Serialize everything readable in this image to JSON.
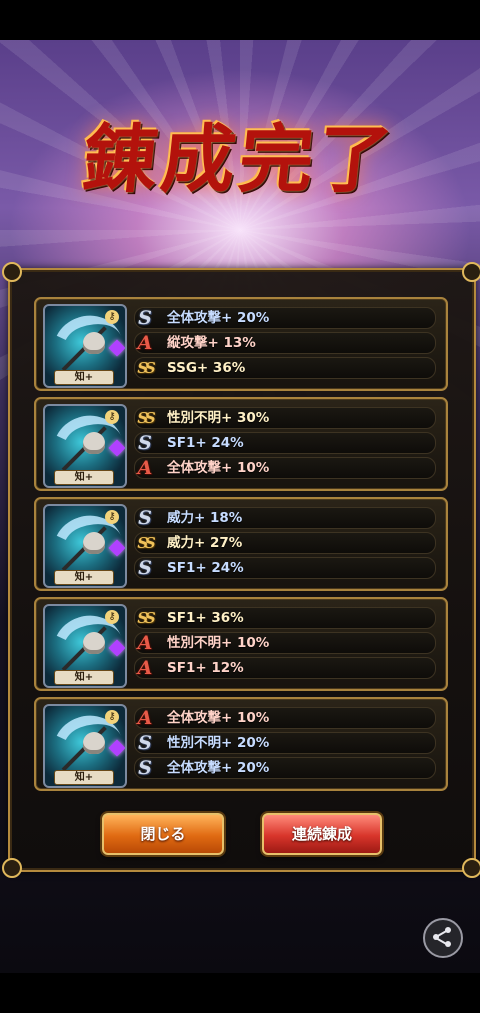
{
  "title": "錬成完了",
  "cards": [
    {
      "type_tag": "知+",
      "stats": [
        {
          "grade": "S",
          "grade_label": "S",
          "text": "全体攻撃+ 20%",
          "tone": "blue"
        },
        {
          "grade": "A",
          "grade_label": "A",
          "text": "縦攻撃+ 13%",
          "tone": "red"
        },
        {
          "grade": "SS",
          "grade_label": "SS",
          "text": "SSG+ 36%",
          "tone": "gold"
        }
      ]
    },
    {
      "type_tag": "知+",
      "stats": [
        {
          "grade": "SS",
          "grade_label": "SS",
          "text": "性別不明+ 30%",
          "tone": "gold"
        },
        {
          "grade": "S",
          "grade_label": "S",
          "text": "SF1+ 24%",
          "tone": "blue"
        },
        {
          "grade": "A",
          "grade_label": "A",
          "text": "全体攻撃+ 10%",
          "tone": "red"
        }
      ]
    },
    {
      "type_tag": "知+",
      "stats": [
        {
          "grade": "S",
          "grade_label": "S",
          "text": "威力+ 18%",
          "tone": "blue"
        },
        {
          "grade": "SS",
          "grade_label": "SS",
          "text": "威力+ 27%",
          "tone": "gold"
        },
        {
          "grade": "S",
          "grade_label": "S",
          "text": "SF1+ 24%",
          "tone": "blue"
        }
      ]
    },
    {
      "type_tag": "知+",
      "stats": [
        {
          "grade": "SS",
          "grade_label": "SS",
          "text": "SF1+ 36%",
          "tone": "gold"
        },
        {
          "grade": "A",
          "grade_label": "A",
          "text": "性別不明+ 10%",
          "tone": "red"
        },
        {
          "grade": "A",
          "grade_label": "A",
          "text": "SF1+ 12%",
          "tone": "red"
        }
      ]
    },
    {
      "type_tag": "知+",
      "stats": [
        {
          "grade": "A",
          "grade_label": "A",
          "text": "全体攻撃+ 10%",
          "tone": "red"
        },
        {
          "grade": "S",
          "grade_label": "S",
          "text": "性別不明+ 20%",
          "tone": "blue"
        },
        {
          "grade": "S",
          "grade_label": "S",
          "text": "全体攻撃+ 20%",
          "tone": "blue"
        }
      ]
    }
  ],
  "buttons": {
    "close_label": "閉じる",
    "repeat_label": "連続錬成"
  },
  "icons": {
    "share": "share-icon",
    "key": "key-icon",
    "gem": "gem-icon"
  },
  "colors": {
    "panel_border": "#b58a3e",
    "close_button": "#e06a12",
    "repeat_button": "#d8352b",
    "title": "#b3120c"
  }
}
